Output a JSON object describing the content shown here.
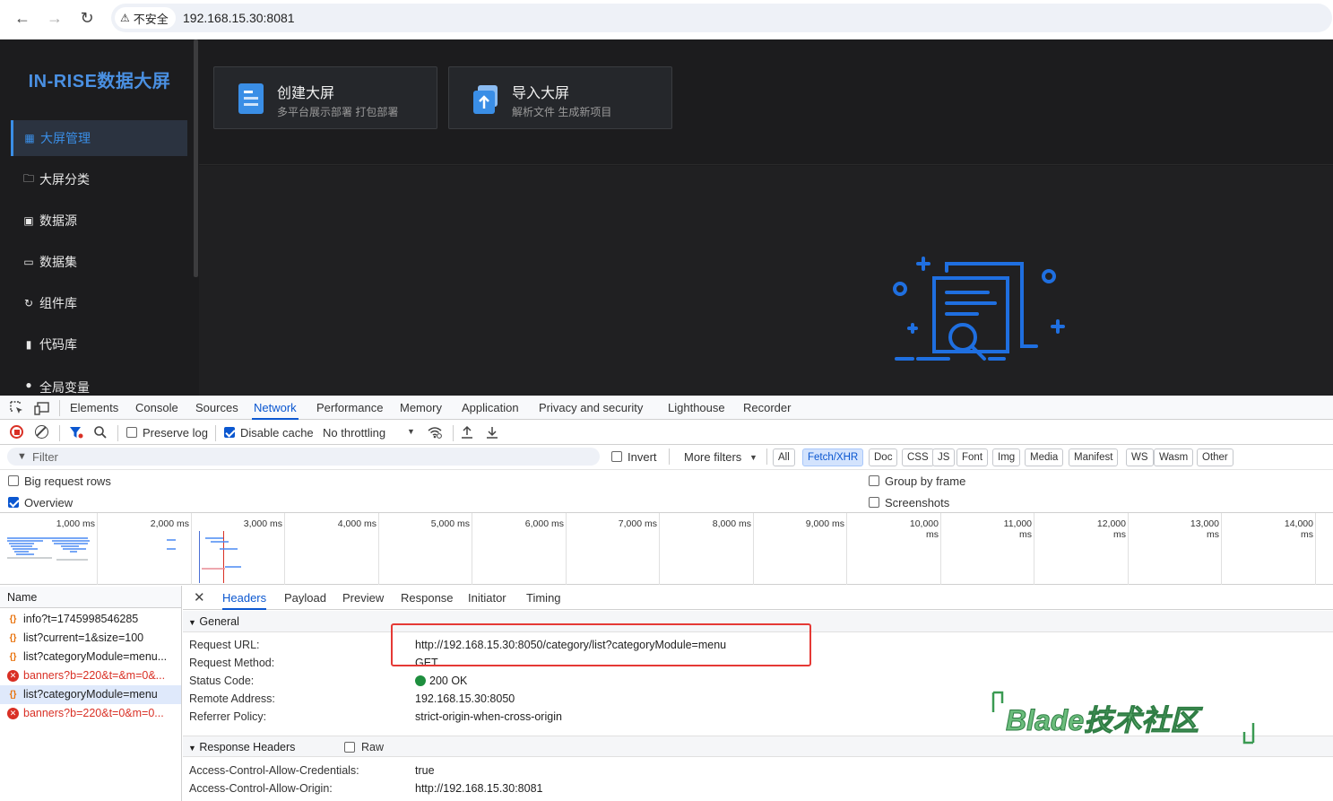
{
  "browser": {
    "security_label": "不安全",
    "url": "192.168.15.30:8081"
  },
  "app": {
    "logo": "IN-RISE数据大屏",
    "menu": [
      {
        "label": "大屏管理",
        "icon": "grid-icon",
        "active": true
      },
      {
        "label": "大屏分类",
        "icon": "folder-icon"
      },
      {
        "label": "数据源",
        "icon": "database-icon"
      },
      {
        "label": "数据集",
        "icon": "dataset-icon"
      },
      {
        "label": "组件库",
        "icon": "component-icon"
      },
      {
        "label": "代码库",
        "icon": "code-icon"
      },
      {
        "label": "全局变量",
        "icon": "bulb-icon"
      }
    ],
    "cards": [
      {
        "title": "创建大屏",
        "subtitle": "多平台展示部署 打包部署",
        "icon": "document-icon"
      },
      {
        "title": "导入大屏",
        "subtitle": "解析文件 生成新项目",
        "icon": "upload-icon"
      }
    ],
    "accent_color": "#3a8ee6"
  },
  "devtools": {
    "tabs": [
      "Elements",
      "Console",
      "Sources",
      "Network",
      "Performance",
      "Memory",
      "Application",
      "Privacy and security",
      "Lighthouse",
      "Recorder"
    ],
    "active_tab": "Network",
    "toolbar": {
      "preserve_log": "Preserve log",
      "disable_cache": "Disable cache",
      "throttling": "No throttling"
    },
    "filter": {
      "placeholder": "Filter",
      "invert": "Invert",
      "more_filters": "More filters",
      "types": [
        "All",
        "Fetch/XHR",
        "Doc",
        "CSS",
        "JS",
        "Font",
        "Img",
        "Media",
        "Manifest",
        "WS",
        "Wasm",
        "Other"
      ],
      "active_type": "Fetch/XHR"
    },
    "options": {
      "big_request_rows": "Big request rows",
      "overview": "Overview",
      "group_by_frame": "Group by frame",
      "screenshots": "Screenshots"
    },
    "timeline_ticks": [
      "1,000 ms",
      "2,000 ms",
      "3,000 ms",
      "4,000 ms",
      "5,000 ms",
      "6,000 ms",
      "7,000 ms",
      "8,000 ms",
      "9,000 ms",
      "10,000 ms",
      "11,000 ms",
      "12,000 ms",
      "13,000 ms",
      "14,000 ms"
    ],
    "requests_header": "Name",
    "requests": [
      {
        "name": "info?t=1745998546285",
        "type": "xhr"
      },
      {
        "name": "list?current=1&size=100",
        "type": "xhr"
      },
      {
        "name": "list?categoryModule=menu...",
        "type": "xhr"
      },
      {
        "name": "banners?b=220&t=&m=0&...",
        "type": "error"
      },
      {
        "name": "list?categoryModule=menu",
        "type": "xhr",
        "selected": true
      },
      {
        "name": "banners?b=220&t=0&m=0...",
        "type": "error"
      }
    ],
    "detail_tabs": [
      "Headers",
      "Payload",
      "Preview",
      "Response",
      "Initiator",
      "Timing"
    ],
    "active_detail_tab": "Headers",
    "general": {
      "title": "General",
      "rows": [
        {
          "key": "Request URL:",
          "value": "http://192.168.15.30:8050/category/list?categoryModule=menu"
        },
        {
          "key": "Request Method:",
          "value": "GET"
        },
        {
          "key": "Status Code:",
          "value": "200 OK"
        },
        {
          "key": "Remote Address:",
          "value": "192.168.15.30:8050"
        },
        {
          "key": "Referrer Policy:",
          "value": "strict-origin-when-cross-origin"
        }
      ]
    },
    "response_headers": {
      "title": "Response Headers",
      "raw_label": "Raw",
      "rows": [
        {
          "key": "Access-Control-Allow-Credentials:",
          "value": "true"
        },
        {
          "key": "Access-Control-Allow-Origin:",
          "value": "http://192.168.15.30:8081"
        }
      ]
    },
    "status_color": "#1e8e3e"
  },
  "watermark": "Blade技术社区"
}
